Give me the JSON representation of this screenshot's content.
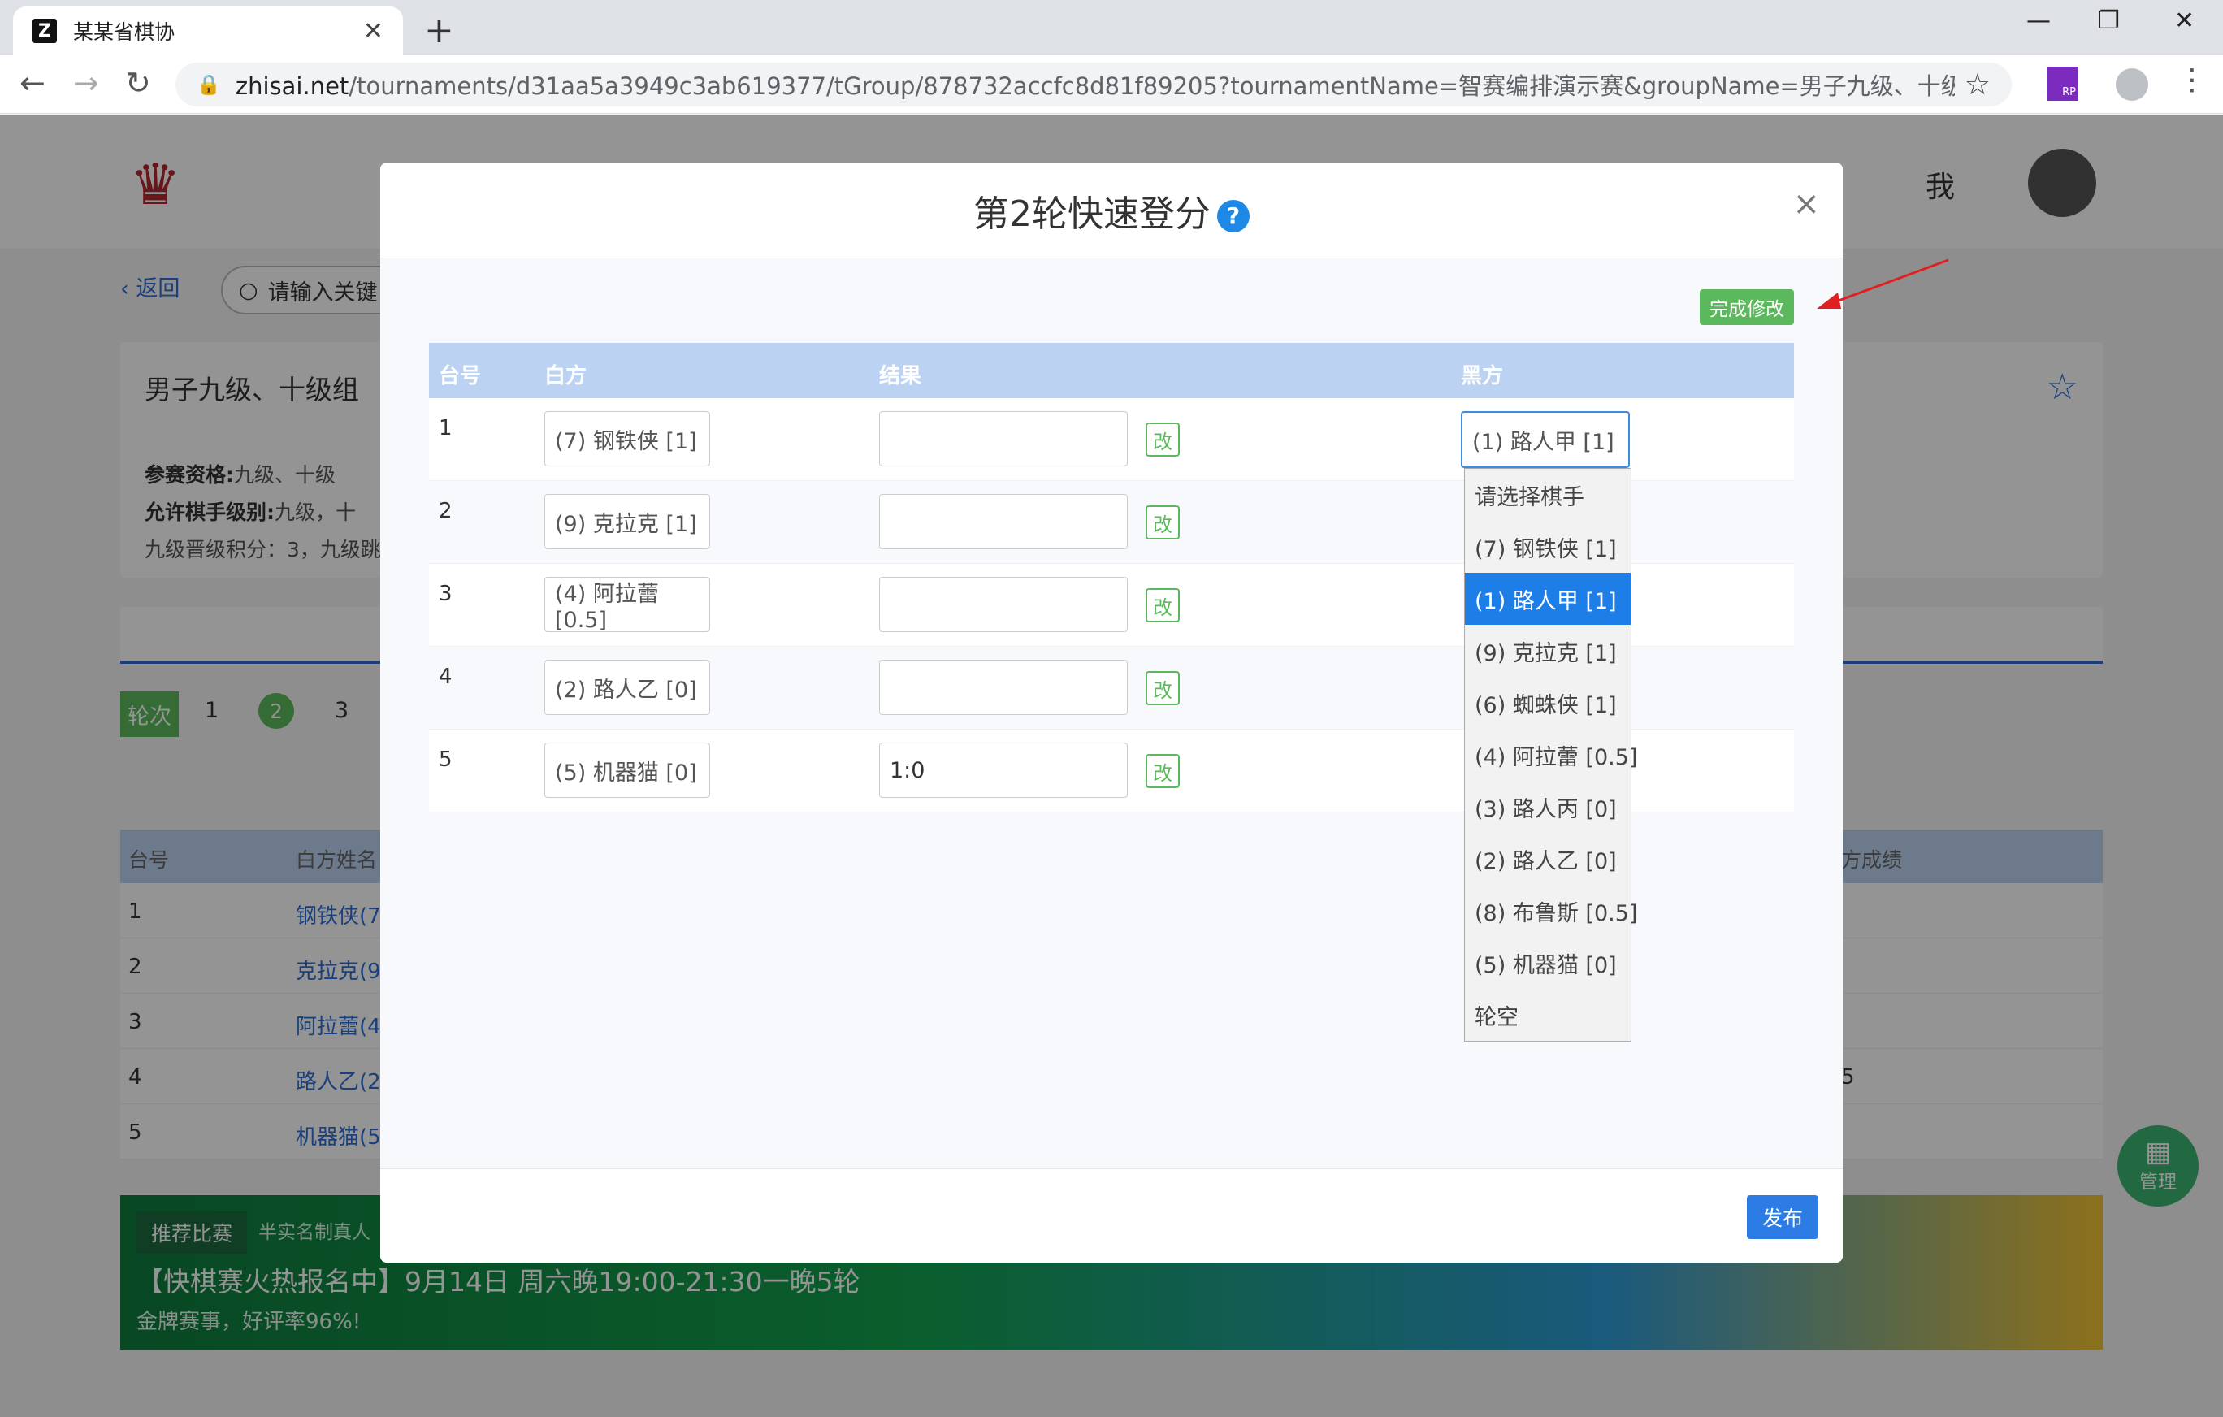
{
  "browser": {
    "tab_title": "某某省棋协",
    "tab_close": "✕",
    "new_tab": "+",
    "url_host": "zhisai.net",
    "url_path": "/tournaments/d31aa5a3949c3ab619377/tGroup/878732accfc8d81f89205?tournamentName=智赛编排演示赛&groupName=男子九级、十级组&roun...",
    "extension_label": "RP"
  },
  "header": {
    "me_label": "我"
  },
  "page": {
    "back_label": "返回",
    "search_placeholder": "请输入关键",
    "group_title": "男子九级、十级组",
    "info_lines": [
      {
        "label": "参赛资格:",
        "value": "九级、十级"
      },
      {
        "label": "允许棋手级别:",
        "value": "九级，十"
      },
      {
        "label": "",
        "value": "九级晋级积分：3，九级跳"
      }
    ],
    "round_label": "轮次",
    "rounds": [
      "1",
      "2",
      "3"
    ],
    "table_headers": [
      "台号",
      "白方姓名",
      "方成绩"
    ],
    "table_rows": [
      {
        "num": "1",
        "white": "钢铁侠(7",
        "extra": ""
      },
      {
        "num": "2",
        "white": "克拉克(9",
        "extra": ""
      },
      {
        "num": "3",
        "white": "阿拉蕾(4",
        "extra": ""
      },
      {
        "num": "4",
        "white": "路人乙(2",
        "extra": "5"
      },
      {
        "num": "5",
        "white": "机器猫(5",
        "extra": ""
      }
    ],
    "banner": {
      "tag": "推荐比赛",
      "sub": "半实名制真人",
      "title": "【快棋赛火热报名中】9月14日 周六晚19:00-21:30一晚5轮",
      "desc": "金牌赛事，好评率96%!"
    },
    "manage_label": "管理"
  },
  "modal": {
    "title": "第2轮快速登分",
    "help": "?",
    "close": "×",
    "done_button": "完成修改",
    "headers": {
      "num": "台号",
      "white": "白方",
      "result": "结果",
      "black": "黑方"
    },
    "edit_label": "改",
    "rows": [
      {
        "num": "1",
        "white": "(7) 钢铁侠 [1]",
        "result": "",
        "black": "(1) 路人甲 [1]"
      },
      {
        "num": "2",
        "white": "(9) 克拉克 [1]",
        "result": ""
      },
      {
        "num": "3",
        "white": "(4) 阿拉蕾 [0.5]",
        "result": ""
      },
      {
        "num": "4",
        "white": "(2) 路人乙 [0]",
        "result": ""
      },
      {
        "num": "5",
        "white": "(5) 机器猫 [0]",
        "result": "1:0"
      }
    ],
    "dropdown_options": [
      "请选择棋手",
      "(7) 钢铁侠 [1]",
      "(1) 路人甲 [1]",
      "(9) 克拉克 [1]",
      "(6) 蜘蛛侠 [1]",
      "(4) 阿拉蕾 [0.5]",
      "(3) 路人丙 [0]",
      "(2) 路人乙 [0]",
      "(8) 布鲁斯 [0.5]",
      "(5) 机器猫 [0]",
      "轮空"
    ],
    "dropdown_selected_index": 2,
    "publish_button": "发布"
  },
  "colors": {
    "accent_blue": "#1e7ee8",
    "accent_green": "#5cb85c",
    "table_header": "#bcd2f2",
    "arrow_red": "#e02020"
  }
}
